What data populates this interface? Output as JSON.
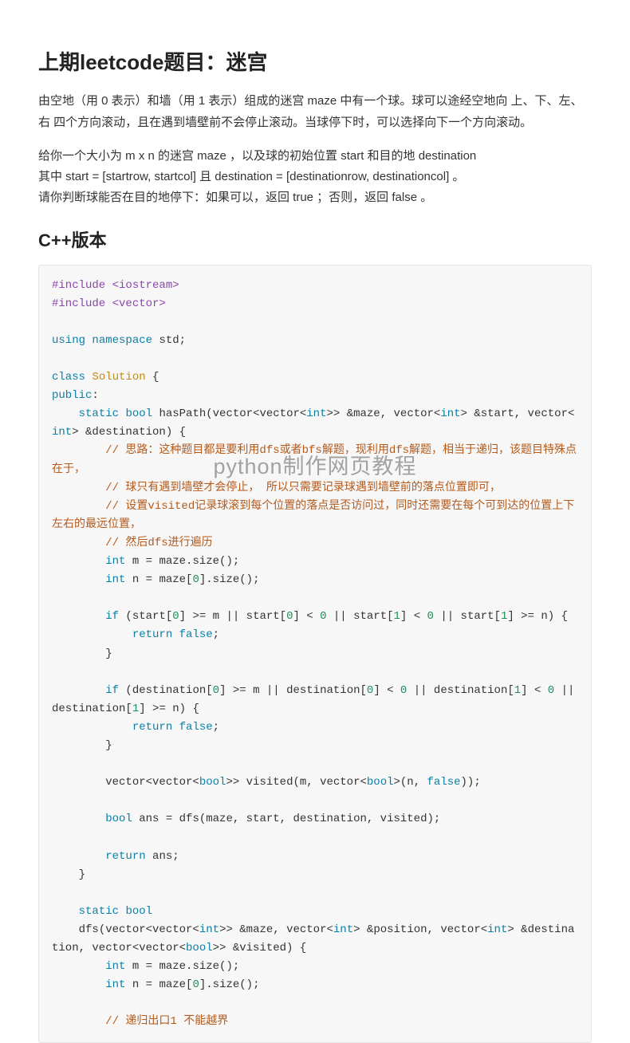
{
  "title": "上期leetcode题目：迷宫",
  "paragraph1": "由空地（用 0 表示）和墙（用 1 表示）组成的迷宫 maze 中有一个球。球可以途经空地向 上、下、左、右 四个方向滚动，且在遇到墙壁前不会停止滚动。当球停下时，可以选择向下一个方向滚动。",
  "paragraph2": "给你一个大小为 m x n 的迷宫 maze ，以及球的初始位置 start 和目的地 destination\n其中 start = [startrow, startcol] 且 destination = [destinationrow, destinationcol] 。\n请你判断球能否在目的地停下：如果可以，返回 true ；否则，返回 false 。",
  "cpp_heading": "C++版本",
  "watermark": "python制作网页教程",
  "code_tokens": [
    [
      "pre",
      "#include "
    ],
    [
      "str",
      "<iostream>"
    ],
    [
      "nl",
      ""
    ],
    [
      "pre",
      "#include "
    ],
    [
      "str",
      "<vector>"
    ],
    [
      "nl",
      ""
    ],
    [
      "nl",
      ""
    ],
    [
      "kw",
      "using"
    ],
    [
      "id",
      " "
    ],
    [
      "kw",
      "namespace"
    ],
    [
      "id",
      " std"
    ],
    [
      "pun",
      ";"
    ],
    [
      "nl",
      ""
    ],
    [
      "nl",
      ""
    ],
    [
      "kw",
      "class"
    ],
    [
      "id",
      " "
    ],
    [
      "typ",
      "Solution"
    ],
    [
      "id",
      " "
    ],
    [
      "pun",
      "{"
    ],
    [
      "nl",
      ""
    ],
    [
      "kw",
      "public"
    ],
    [
      "pun",
      ":"
    ],
    [
      "nl",
      ""
    ],
    [
      "id",
      "    "
    ],
    [
      "kw",
      "static"
    ],
    [
      "id",
      " "
    ],
    [
      "kw",
      "bool"
    ],
    [
      "id",
      " hasPath(vector<vector<"
    ],
    [
      "kw",
      "int"
    ],
    [
      "id",
      ">> &maze, vector<"
    ],
    [
      "kw",
      "int"
    ],
    [
      "id",
      "> &start, vector<"
    ],
    [
      "kw",
      "int"
    ],
    [
      "id",
      "> &destination) {"
    ],
    [
      "nl",
      ""
    ],
    [
      "id",
      "        "
    ],
    [
      "cmt",
      "// 思路：这种题目都是要利用dfs或者bfs解题，现利用dfs解题，相当于递归，该题目特殊点在于，"
    ],
    [
      "nl",
      ""
    ],
    [
      "id",
      "        "
    ],
    [
      "cmt",
      "// 球只有遇到墙壁才会停止， 所以只需要记录球遇到墙壁前的落点位置即可，"
    ],
    [
      "nl",
      ""
    ],
    [
      "id",
      "        "
    ],
    [
      "cmt",
      "// 设置visited记录球滚到每个位置的落点是否访问过，同时还需要在每个可到达的位置上下左右的最远位置，"
    ],
    [
      "nl",
      ""
    ],
    [
      "id",
      "        "
    ],
    [
      "cmt",
      "// 然后dfs进行遍历"
    ],
    [
      "nl",
      ""
    ],
    [
      "id",
      "        "
    ],
    [
      "kw",
      "int"
    ],
    [
      "id",
      " m = maze.size();"
    ],
    [
      "nl",
      ""
    ],
    [
      "id",
      "        "
    ],
    [
      "kw",
      "int"
    ],
    [
      "id",
      " n = maze["
    ],
    [
      "num",
      "0"
    ],
    [
      "id",
      "].size();"
    ],
    [
      "nl",
      ""
    ],
    [
      "nl",
      ""
    ],
    [
      "id",
      "        "
    ],
    [
      "kw",
      "if"
    ],
    [
      "id",
      " (start["
    ],
    [
      "num",
      "0"
    ],
    [
      "id",
      "] >= m || start["
    ],
    [
      "num",
      "0"
    ],
    [
      "id",
      "] < "
    ],
    [
      "num",
      "0"
    ],
    [
      "id",
      " || start["
    ],
    [
      "num",
      "1"
    ],
    [
      "id",
      "] < "
    ],
    [
      "num",
      "0"
    ],
    [
      "id",
      " || start["
    ],
    [
      "num",
      "1"
    ],
    [
      "id",
      "] >= n) {"
    ],
    [
      "nl",
      ""
    ],
    [
      "id",
      "            "
    ],
    [
      "kw",
      "return"
    ],
    [
      "id",
      " "
    ],
    [
      "kw",
      "false"
    ],
    [
      "pun",
      ";"
    ],
    [
      "nl",
      ""
    ],
    [
      "id",
      "        }"
    ],
    [
      "nl",
      ""
    ],
    [
      "nl",
      ""
    ],
    [
      "id",
      "        "
    ],
    [
      "kw",
      "if"
    ],
    [
      "id",
      " (destination["
    ],
    [
      "num",
      "0"
    ],
    [
      "id",
      "] >= m || destination["
    ],
    [
      "num",
      "0"
    ],
    [
      "id",
      "] < "
    ],
    [
      "num",
      "0"
    ],
    [
      "id",
      " || destination["
    ],
    [
      "num",
      "1"
    ],
    [
      "id",
      "] < "
    ],
    [
      "num",
      "0"
    ],
    [
      "id",
      " || destination["
    ],
    [
      "num",
      "1"
    ],
    [
      "id",
      "] >= n) {"
    ],
    [
      "nl",
      ""
    ],
    [
      "id",
      "            "
    ],
    [
      "kw",
      "return"
    ],
    [
      "id",
      " "
    ],
    [
      "kw",
      "false"
    ],
    [
      "pun",
      ";"
    ],
    [
      "nl",
      ""
    ],
    [
      "id",
      "        }"
    ],
    [
      "nl",
      ""
    ],
    [
      "nl",
      ""
    ],
    [
      "id",
      "        vector<vector<"
    ],
    [
      "kw",
      "bool"
    ],
    [
      "id",
      ">> visited(m, vector<"
    ],
    [
      "kw",
      "bool"
    ],
    [
      "id",
      ">(n, "
    ],
    [
      "kw",
      "false"
    ],
    [
      "id",
      "));"
    ],
    [
      "nl",
      ""
    ],
    [
      "nl",
      ""
    ],
    [
      "id",
      "        "
    ],
    [
      "kw",
      "bool"
    ],
    [
      "id",
      " ans = dfs(maze, start, destination, visited);"
    ],
    [
      "nl",
      ""
    ],
    [
      "nl",
      ""
    ],
    [
      "id",
      "        "
    ],
    [
      "kw",
      "return"
    ],
    [
      "id",
      " ans;"
    ],
    [
      "nl",
      ""
    ],
    [
      "id",
      "    }"
    ],
    [
      "nl",
      ""
    ],
    [
      "nl",
      ""
    ],
    [
      "id",
      "    "
    ],
    [
      "kw",
      "static"
    ],
    [
      "id",
      " "
    ],
    [
      "kw",
      "bool"
    ],
    [
      "nl",
      ""
    ],
    [
      "id",
      "    dfs(vector<vector<"
    ],
    [
      "kw",
      "int"
    ],
    [
      "id",
      ">> &maze, vector<"
    ],
    [
      "kw",
      "int"
    ],
    [
      "id",
      "> &position, vector<"
    ],
    [
      "kw",
      "int"
    ],
    [
      "id",
      "> &destination, vector<vector<"
    ],
    [
      "kw",
      "bool"
    ],
    [
      "id",
      ">> &visited) {"
    ],
    [
      "nl",
      ""
    ],
    [
      "id",
      "        "
    ],
    [
      "kw",
      "int"
    ],
    [
      "id",
      " m = maze.size();"
    ],
    [
      "nl",
      ""
    ],
    [
      "id",
      "        "
    ],
    [
      "kw",
      "int"
    ],
    [
      "id",
      " n = maze["
    ],
    [
      "num",
      "0"
    ],
    [
      "id",
      "].size();"
    ],
    [
      "nl",
      ""
    ],
    [
      "nl",
      ""
    ],
    [
      "id",
      "        "
    ],
    [
      "cmt",
      "// 递归出口1 不能越界"
    ]
  ]
}
